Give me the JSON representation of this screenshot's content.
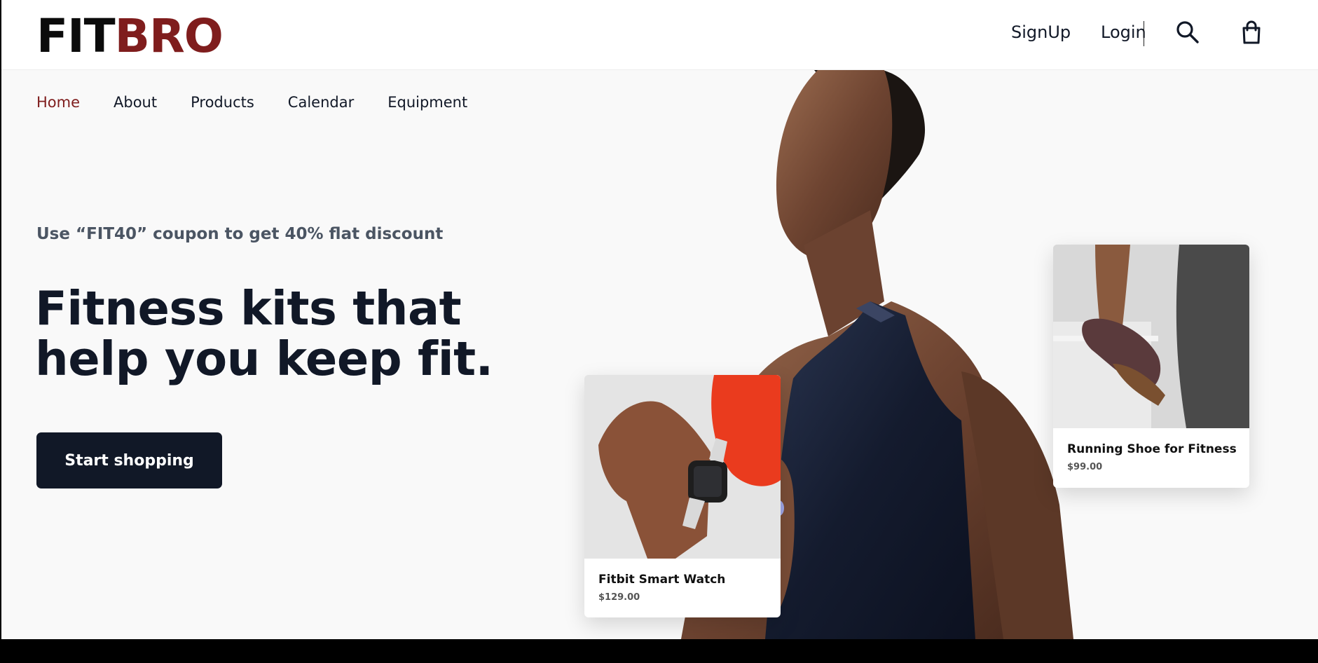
{
  "brand": {
    "part1": "FIT",
    "part2": "BRO"
  },
  "header": {
    "signup": "SignUp",
    "login": "Login"
  },
  "nav": {
    "home": "Home",
    "about": "About",
    "products": "Products",
    "calendar": "Calendar",
    "equipment": "Equipment"
  },
  "hero": {
    "coupon": "Use “FIT40” coupon to get 40% flat discount",
    "headline_line1": "Fitness kits that",
    "headline_line2": "help you keep fit.",
    "cta": "Start shopping"
  },
  "products": [
    {
      "name": "Fitbit Smart Watch",
      "price": "$129.00"
    },
    {
      "name": "Running Shoe for Fitness",
      "price": "$99.00"
    }
  ],
  "colors": {
    "brand_dark": "#0b0b0b",
    "brand_accent": "#7f1d1d",
    "button_bg": "#111827"
  }
}
